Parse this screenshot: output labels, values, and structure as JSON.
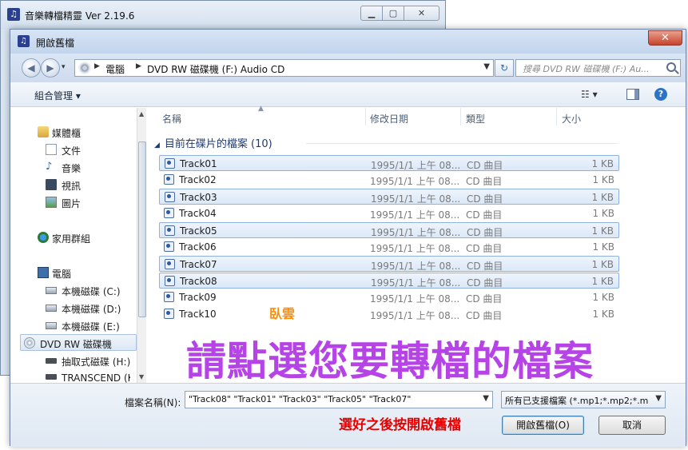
{
  "app_window": {
    "title": "音樂轉檔精靈 Ver 2.19.6",
    "controls": {
      "minimize": "▁",
      "maximize": "▢",
      "close": "✕"
    }
  },
  "dialog": {
    "title": "開啟舊檔",
    "close_label": "✕",
    "address": {
      "segments": [
        "電腦",
        "DVD RW 磁碟機 (F:) Audio CD"
      ],
      "search_placeholder": "搜尋 DVD RW 磁碟機 (F:) Au..."
    },
    "toolbar": {
      "organize_label": "組合管理 ▾",
      "view_label": "☷ ▾",
      "help_label": "?"
    },
    "nav": {
      "items": [
        {
          "label": "媒體櫃",
          "icon": "library-icon",
          "indent": 0
        },
        {
          "label": "文件",
          "icon": "document-icon",
          "indent": 1
        },
        {
          "label": "音樂",
          "icon": "music-icon",
          "indent": 1
        },
        {
          "label": "視訊",
          "icon": "video-icon",
          "indent": 1
        },
        {
          "label": "圖片",
          "icon": "picture-icon",
          "indent": 1
        },
        {
          "label": "家用群組",
          "icon": "homegroup-icon",
          "indent": 0
        },
        {
          "label": "電腦",
          "icon": "computer-icon",
          "indent": 0
        },
        {
          "label": "本機磁碟 (C:)",
          "icon": "drive-icon",
          "indent": 1
        },
        {
          "label": "本機磁碟 (D:)",
          "icon": "drive-icon",
          "indent": 1
        },
        {
          "label": "本機磁碟 (E:)",
          "icon": "drive-icon",
          "indent": 1
        },
        {
          "label": "DVD RW 磁碟機",
          "icon": "dvd-icon",
          "indent": 1,
          "selected": true
        },
        {
          "label": "抽取式磁碟 (H:)",
          "icon": "usb-drive-icon",
          "indent": 1
        },
        {
          "label": "TRANSCEND (K",
          "icon": "usb-drive-icon",
          "indent": 1
        }
      ]
    },
    "columns": {
      "name": "名稱",
      "date": "修改日期",
      "type": "類型",
      "size": "大小"
    },
    "group_header": "目前在碟片的檔案 (10)",
    "files": [
      {
        "name": "Track01",
        "date": "1995/1/1 上午 08...",
        "type": "CD 曲目",
        "size": "1 KB",
        "selected": true
      },
      {
        "name": "Track02",
        "date": "1995/1/1 上午 08...",
        "type": "CD 曲目",
        "size": "1 KB",
        "selected": false
      },
      {
        "name": "Track03",
        "date": "1995/1/1 上午 08...",
        "type": "CD 曲目",
        "size": "1 KB",
        "selected": true
      },
      {
        "name": "Track04",
        "date": "1995/1/1 上午 08...",
        "type": "CD 曲目",
        "size": "1 KB",
        "selected": false
      },
      {
        "name": "Track05",
        "date": "1995/1/1 上午 08...",
        "type": "CD 曲目",
        "size": "1 KB",
        "selected": true
      },
      {
        "name": "Track06",
        "date": "1995/1/1 上午 08...",
        "type": "CD 曲目",
        "size": "1 KB",
        "selected": false
      },
      {
        "name": "Track07",
        "date": "1995/1/1 上午 08...",
        "type": "CD 曲目",
        "size": "1 KB",
        "selected": true
      },
      {
        "name": "Track08",
        "date": "1995/1/1 上午 08...",
        "type": "CD 曲目",
        "size": "1 KB",
        "selected": true
      },
      {
        "name": "Track09",
        "date": "1995/1/1 上午 08...",
        "type": "CD 曲目",
        "size": "1 KB",
        "selected": false
      },
      {
        "name": "Track10",
        "date": "1995/1/1 上午 08...",
        "type": "CD 曲目",
        "size": "1 KB",
        "selected": false
      }
    ],
    "filename_label": "檔案名稱(N):",
    "filename_value": "\"Track08\" \"Track01\" \"Track03\" \"Track05\" \"Track07\"",
    "filter_value": "所有已支援檔案 (*.mp1;*.mp2;*.m",
    "open_button": "開啟舊檔(O)",
    "cancel_button": "取消"
  },
  "overlay": {
    "author": "臥雲",
    "instruction": "請點選您要轉檔的檔案",
    "hint": "選好之後按開啟舊檔"
  },
  "colors": {
    "selection_border": "#8fb1dc",
    "instruction_text": "#b543e6",
    "hint_text": "#e60000",
    "author_text": "#ff8c00"
  }
}
